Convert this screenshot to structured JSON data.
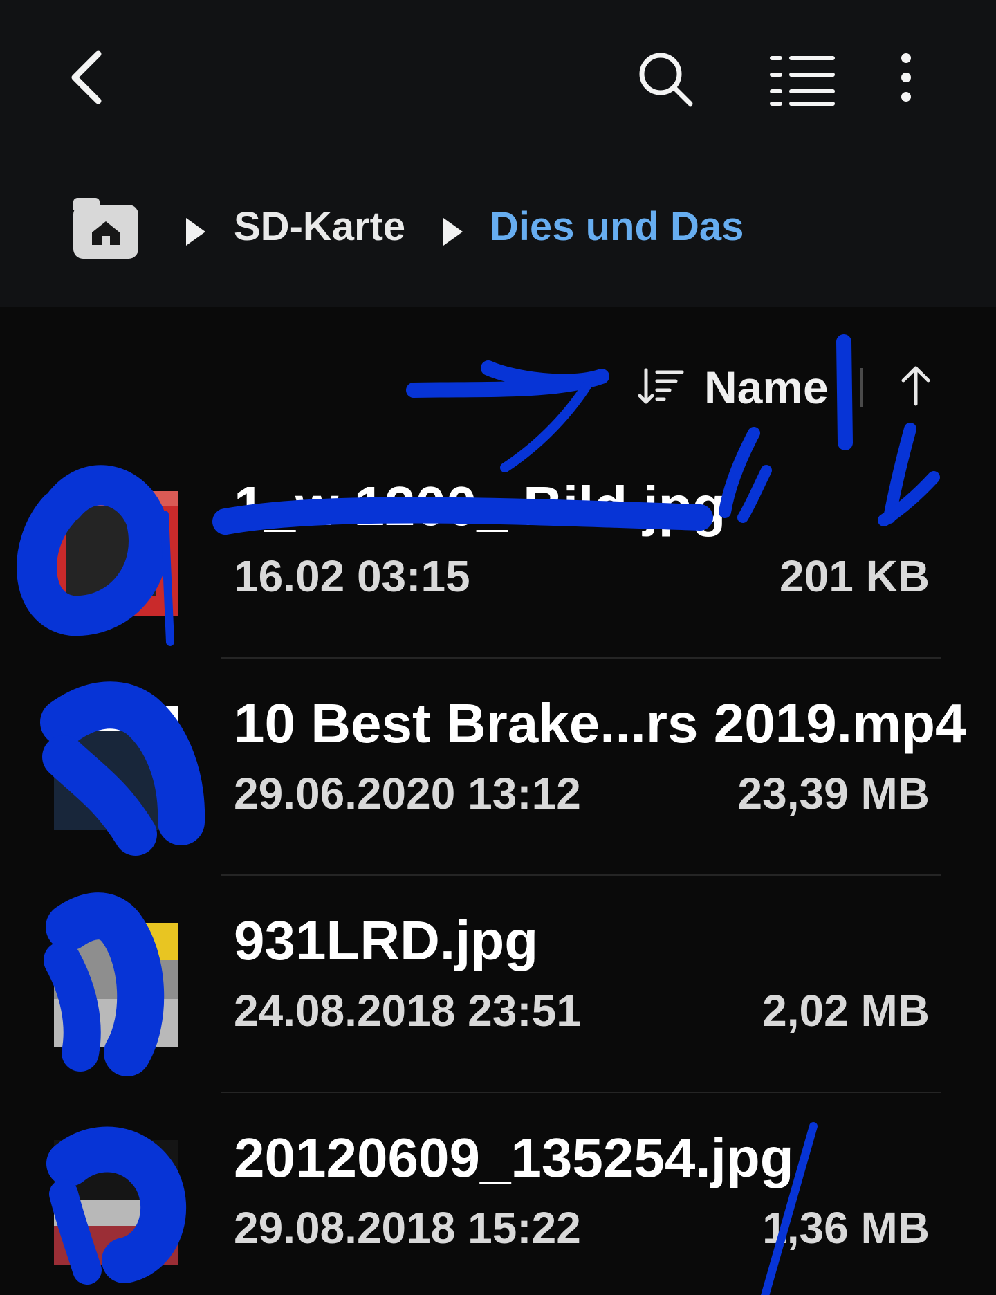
{
  "toolbar": {
    "back_icon": "chevron-left-icon",
    "search_icon": "search-icon",
    "list_view_icon": "list-view-icon",
    "more_icon": "more-vertical-icon"
  },
  "breadcrumb": {
    "home_icon": "home-folder-icon",
    "separator_icon": "triangle-right-icon",
    "items": [
      {
        "label": "SD-Karte"
      },
      {
        "label": "Dies und Das"
      }
    ],
    "current_color": "#67adf0"
  },
  "sort": {
    "icon": "sort-icon",
    "label": "Name",
    "direction_icon": "arrow-up-icon"
  },
  "files": [
    {
      "name": "1_w 1200_ Bild.jpg",
      "date": "16.02 03:15",
      "size": "201 KB"
    },
    {
      "name": "10 Best Brake...rs 2019.mp4",
      "date": "29.06.2020 13:12",
      "size": "23,39 MB"
    },
    {
      "name": "931LRD.jpg",
      "date": "24.08.2018 23:51",
      "size": "2,02 MB"
    },
    {
      "name": "20120609_135254.jpg",
      "date": "29.08.2018 15:22",
      "size": "1,36 MB"
    }
  ],
  "colors": {
    "background": "#0a0a0a",
    "header": "#111214",
    "annotation_blue": "#0734d6"
  }
}
